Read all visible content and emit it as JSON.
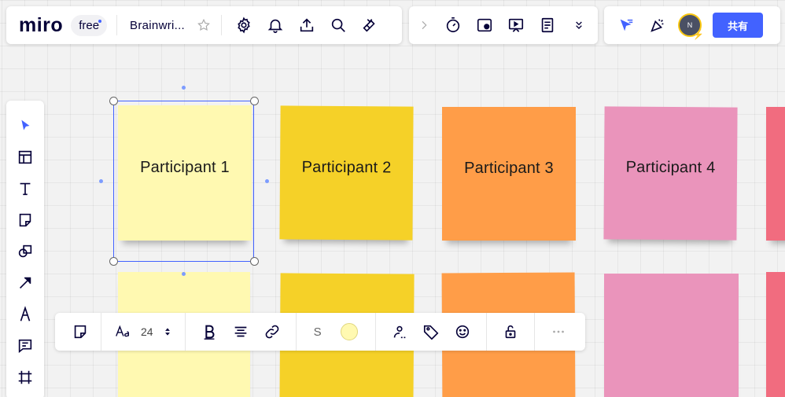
{
  "app": {
    "logo": "miro",
    "plan": "free",
    "board_title": "Brainwri..."
  },
  "topbar": {
    "left_icons": [
      "star-icon",
      "gear-icon",
      "bell-icon",
      "upload-icon",
      "search-icon",
      "plugin-icon"
    ],
    "middle_icons": [
      "chevron-right-icon",
      "timer-icon",
      "screen-record-icon",
      "presentation-icon",
      "notes-icon",
      "double-chevron-down-icon"
    ],
    "avatar_initial": "N",
    "share_label": "共有"
  },
  "stickies": {
    "row1": [
      {
        "label": "Participant 1",
        "color": "#fff9b1"
      },
      {
        "label": "Participant 2",
        "color": "#f5d128"
      },
      {
        "label": "Participant 3",
        "color": "#ff9d48"
      },
      {
        "label": "Participant 4",
        "color": "#ea94bb"
      }
    ],
    "edge_color": "#f16c7f"
  },
  "context_toolbar": {
    "font_size": "24",
    "stroke_label": "S",
    "fill_color": "#fff9b1"
  },
  "colors": {
    "accent": "#4262ff",
    "text": "#050038"
  }
}
